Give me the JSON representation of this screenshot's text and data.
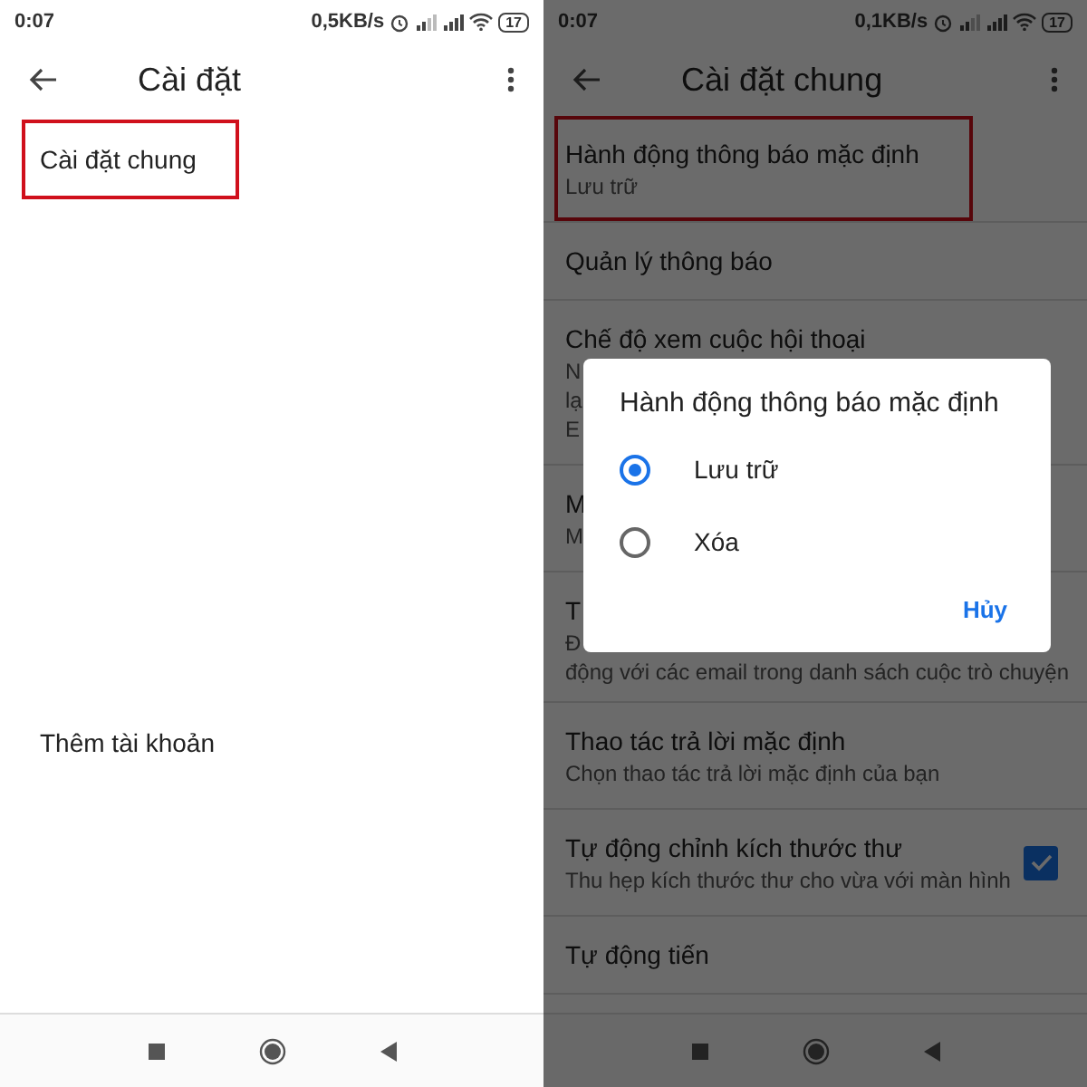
{
  "left_screen": {
    "status_bar": {
      "time": "0:07",
      "speed": "0,5KB/s",
      "battery": "17"
    },
    "toolbar": {
      "title": "Cài đặt"
    },
    "items": [
      {
        "kind": "setting",
        "title": "Cài đặt chung",
        "highlighted": true
      },
      {
        "kind": "account",
        "title": "Thêm tài khoản",
        "highlighted": false
      }
    ]
  },
  "right_screen": {
    "status_bar": {
      "time": "0:07",
      "speed": "0,1KB/s",
      "battery": "17"
    },
    "toolbar": {
      "title": "Cài đặt chung"
    },
    "rows": [
      {
        "kind": "text",
        "title": "Hành động thông báo mặc định",
        "subtitle_lines": [
          "Lưu trữ"
        ],
        "highlighted": true
      },
      {
        "kind": "text",
        "title": "Quản lý thông báo",
        "subtitle_lines": [],
        "highlighted": false
      },
      {
        "kind": "text",
        "title": "Chế độ xem cuộc hội thoại",
        "subtitle_lines": [
          "N",
          "lạ",
          "E"
        ],
        "highlighted": false
      },
      {
        "kind": "text",
        "title": "M",
        "subtitle_lines": [
          "M"
        ],
        "highlighted": false
      },
      {
        "kind": "text",
        "title": "T",
        "subtitle_lines": [
          "Đ",
          "động với các email trong danh sách cuộc trò chuyện"
        ],
        "highlighted": false
      },
      {
        "kind": "text",
        "title": "Thao tác trả lời mặc định",
        "subtitle_lines": [
          "Chọn thao tác trả lời mặc định của bạn"
        ],
        "highlighted": false
      },
      {
        "kind": "checkbox",
        "title": "Tự động chỉnh kích thước thư",
        "subtitle_lines": [
          "Thu hẹp kích thước thư cho vừa với màn hình"
        ],
        "highlighted": false,
        "checked": true
      },
      {
        "kind": "text",
        "title": "Tự động tiến",
        "subtitle_lines": [],
        "highlighted": false
      }
    ],
    "dialog": {
      "title": "Hành động thông báo mặc định",
      "options": [
        {
          "label": "Lưu trữ",
          "selected": true
        },
        {
          "label": "Xóa",
          "selected": false
        }
      ],
      "button": "Hủy"
    }
  }
}
